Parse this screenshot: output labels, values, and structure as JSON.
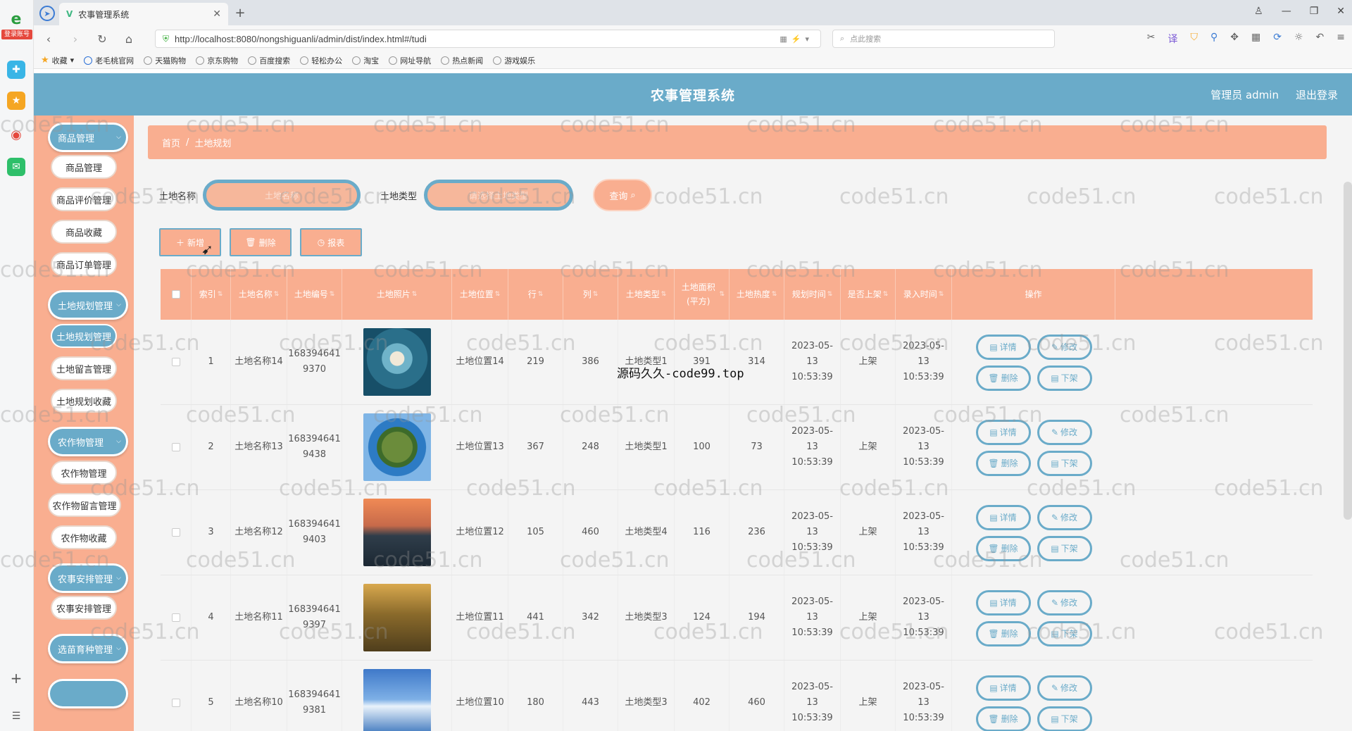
{
  "browser": {
    "tab_title": "农事管理系统",
    "url": "http://localhost:8080/nongshiguanli/admin/dist/index.html#/tudi",
    "search_placeholder": "点此搜索",
    "rail_badge": "登录账号",
    "bookmarks": [
      "收藏",
      "老毛桃官网",
      "天猫购物",
      "京东购物",
      "百度搜索",
      "轻松办公",
      "淘宝",
      "网址导航",
      "热点新闻",
      "游戏娱乐"
    ]
  },
  "header": {
    "title": "农事管理系统",
    "user": "管理员 admin",
    "logout": "退出登录"
  },
  "sidebar": {
    "groups": [
      {
        "label": "商品管理",
        "items": [
          "商品管理",
          "商品评价管理",
          "商品收藏",
          "商品订单管理"
        ]
      },
      {
        "label": "土地规划管理",
        "items": [
          "土地规划管理",
          "土地留言管理",
          "土地规划收藏"
        ]
      },
      {
        "label": "农作物管理",
        "items": [
          "农作物管理",
          "农作物留言管理",
          "农作物收藏"
        ]
      },
      {
        "label": "农事安排管理",
        "items": [
          "农事安排管理"
        ]
      },
      {
        "label": "选苗育种管理",
        "items": []
      }
    ]
  },
  "breadcrumb": {
    "home": "首页",
    "current": "土地规划"
  },
  "search": {
    "name_label": "土地名称",
    "name_placeholder": "土地名称",
    "type_label": "土地类型",
    "type_placeholder": "请选择土地类型",
    "query_label": "查询"
  },
  "actions": {
    "add": "新增",
    "delete": "删除",
    "report": "报表"
  },
  "table": {
    "headers": [
      "索引",
      "土地名称",
      "土地编号",
      "土地照片",
      "土地位置",
      "行",
      "列",
      "土地类型",
      "土地面积(平方)",
      "土地热度",
      "规划时间",
      "是否上架",
      "录入时间",
      "操作"
    ],
    "rows": [
      {
        "index": "1",
        "name": "土地名称14",
        "code": "168394641\n9370",
        "location": "土地位置14",
        "row": "219",
        "col": "386",
        "type": "土地类型1",
        "area": "391",
        "heat": "314",
        "plan_time": "2023-05-13\n10:53:39",
        "listed": "上架",
        "entry_time": "2023-05-13\n10:53:39"
      },
      {
        "index": "2",
        "name": "土地名称13",
        "code": "168394641\n9438",
        "location": "土地位置13",
        "row": "367",
        "col": "248",
        "type": "土地类型1",
        "area": "100",
        "heat": "73",
        "plan_time": "2023-05-13\n10:53:39",
        "listed": "上架",
        "entry_time": "2023-05-13\n10:53:39"
      },
      {
        "index": "3",
        "name": "土地名称12",
        "code": "168394641\n9403",
        "location": "土地位置12",
        "row": "105",
        "col": "460",
        "type": "土地类型4",
        "area": "116",
        "heat": "236",
        "plan_time": "2023-05-13\n10:53:39",
        "listed": "上架",
        "entry_time": "2023-05-13\n10:53:39"
      },
      {
        "index": "4",
        "name": "土地名称11",
        "code": "168394641\n9397",
        "location": "土地位置11",
        "row": "441",
        "col": "342",
        "type": "土地类型3",
        "area": "124",
        "heat": "194",
        "plan_time": "2023-05-13\n10:53:39",
        "listed": "上架",
        "entry_time": "2023-05-13\n10:53:39"
      },
      {
        "index": "5",
        "name": "土地名称10",
        "code": "168394641\n9381",
        "location": "土地位置10",
        "row": "180",
        "col": "443",
        "type": "土地类型3",
        "area": "402",
        "heat": "460",
        "plan_time": "2023-05-13\n10:53:39",
        "listed": "上架",
        "entry_time": "2023-05-13\n10:53:39"
      }
    ],
    "op_labels": {
      "detail": "详情",
      "edit": "修改",
      "delete": "删除",
      "unlist": "下架"
    }
  },
  "overlay_text": "源码久久-code99.top",
  "watermark": "code51.cn",
  "colors": {
    "accent": "#6aabc9",
    "salmon": "#f9ae90"
  }
}
